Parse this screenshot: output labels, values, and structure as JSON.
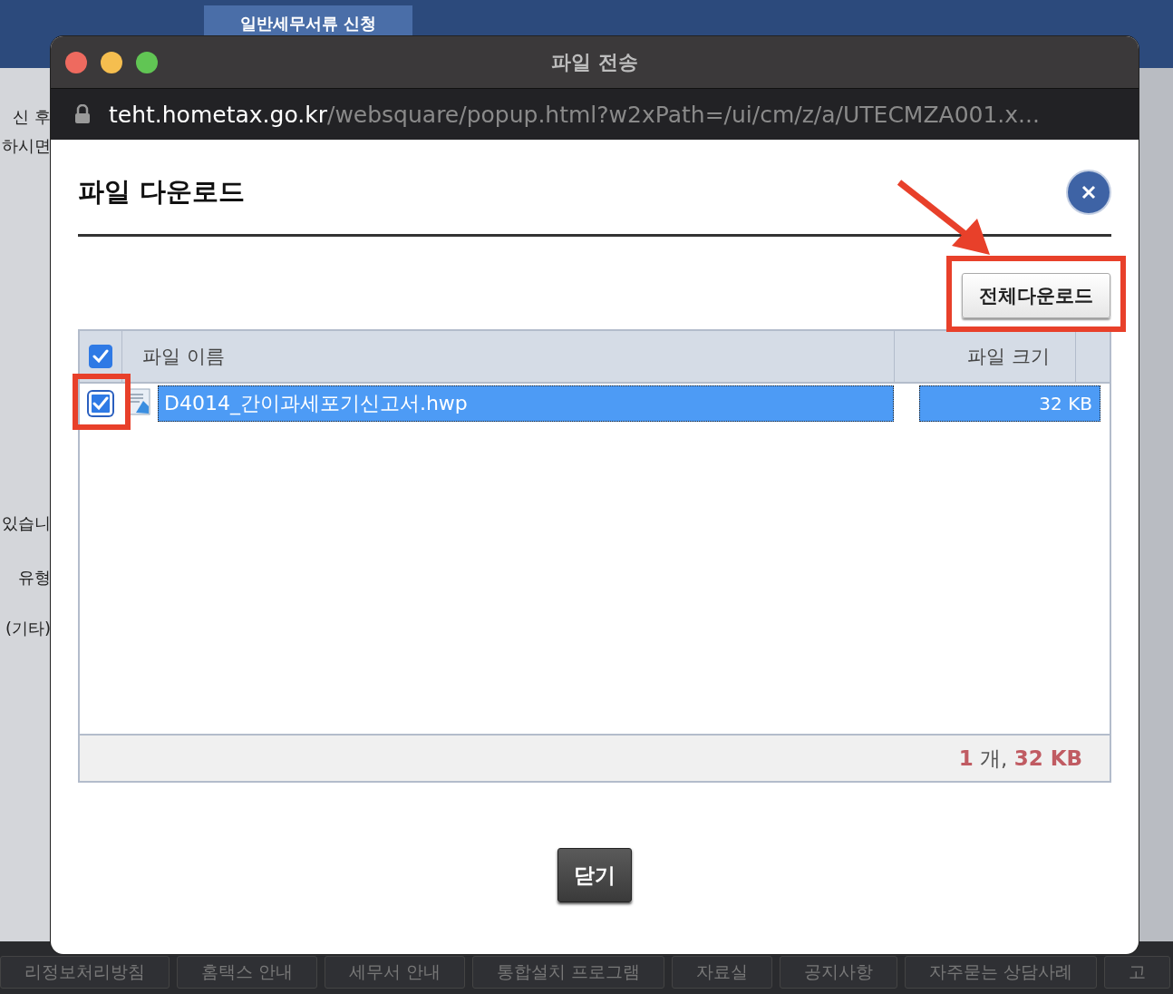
{
  "background": {
    "tab": "일반세무서류 신청",
    "side_texts": [
      "신 후",
      "하시면",
      "있습니",
      "유형",
      "(기타)"
    ],
    "footer_links": [
      "리정보처리방침",
      "홈택스 안내",
      "세무서 안내",
      "통합설치 프로그램",
      "자료실",
      "공지사항",
      "자주묻는 상담사례",
      "고"
    ]
  },
  "window": {
    "title": "파일 전송",
    "url_host": "teht.hometax.go.kr",
    "url_path": "/websquare/popup.html?w2xPath=/ui/cm/z/a/UTECMZA001.x..."
  },
  "dialog": {
    "title": "파일 다운로드",
    "download_all": "전체다운로드",
    "columns": [
      "파일 이름",
      "파일 크기"
    ],
    "select_all": {
      "checked": true
    },
    "files": [
      {
        "name": "D4014_간이과세포기신고서.hwp",
        "size": "32 KB",
        "checked": true,
        "selected": true
      }
    ],
    "summary": "**1** 개, **32 KB**",
    "close_button": "닫기"
  }
}
